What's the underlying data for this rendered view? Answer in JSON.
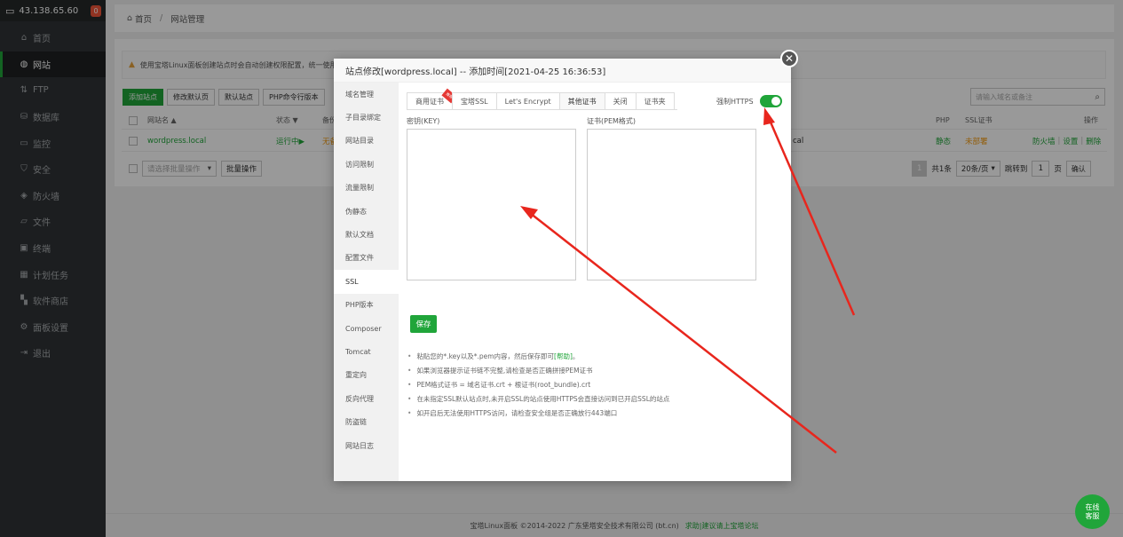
{
  "sidebar": {
    "server_ip": "43.138.65.60",
    "badge": "0",
    "items": [
      {
        "label": "首页",
        "icon": "home-icon",
        "glyph": "⌂"
      },
      {
        "label": "网站",
        "icon": "globe-icon",
        "glyph": "◍",
        "active": true
      },
      {
        "label": "FTP",
        "icon": "ftp-icon",
        "glyph": "⇅"
      },
      {
        "label": "数据库",
        "icon": "database-icon",
        "glyph": "⛁"
      },
      {
        "label": "监控",
        "icon": "monitor-icon",
        "glyph": "▭"
      },
      {
        "label": "安全",
        "icon": "shield-icon",
        "glyph": "⛉"
      },
      {
        "label": "防火墙",
        "icon": "firewall-icon",
        "glyph": "◈"
      },
      {
        "label": "文件",
        "icon": "folder-icon",
        "glyph": "▱"
      },
      {
        "label": "终端",
        "icon": "terminal-icon",
        "glyph": "▣"
      },
      {
        "label": "计划任务",
        "icon": "calendar-icon",
        "glyph": "▦"
      },
      {
        "label": "软件商店",
        "icon": "apps-icon",
        "glyph": "▚"
      },
      {
        "label": "面板设置",
        "icon": "gear-icon",
        "glyph": "⚙"
      },
      {
        "label": "退出",
        "icon": "logout-icon",
        "glyph": "⇥"
      }
    ]
  },
  "breadcrumb": {
    "home": "首页",
    "sep": "/",
    "current": "网站管理"
  },
  "notice": "使用宝塔Linux面板创建站点时会自动创建权限配置，统一使用",
  "toolbar": {
    "add_site": "添加站点",
    "modify_default": "修改默认页",
    "default_site": "默认站点",
    "php_cli": "PHP命令行版本"
  },
  "search_placeholder": "请输入域名或备注",
  "table": {
    "headers": {
      "name": "网站名 ▲",
      "status": "状态 ▼",
      "backup": "备份",
      "php": "PHP",
      "ssl": "SSL证书",
      "ops": "操作"
    },
    "row": {
      "name": "wordpress.local",
      "status": "运行中▶",
      "backup": "无备",
      "tail": "cal",
      "php": "静态",
      "ssl": "未部署",
      "firewall": "防火墙",
      "settings": "设置",
      "delete": "删除",
      "divider": "|"
    }
  },
  "footer_bar": {
    "batch_placeholder": "请选择批量操作",
    "batch_button": "批量操作",
    "page": "1",
    "total": "共1条",
    "per_page": "20条/页",
    "goto": "跳转到",
    "goto_value": "1",
    "page_unit": "页",
    "confirm": "确认"
  },
  "modal": {
    "title": "站点修改[wordpress.local] -- 添加时间[2021-04-25 16:36:53]",
    "close": "✕",
    "side_menu": [
      "域名管理",
      "子目录绑定",
      "网站目录",
      "访问限制",
      "流量限制",
      "伪静态",
      "默认文档",
      "配置文件",
      "SSL",
      "PHP版本",
      "Composer",
      "Tomcat",
      "重定向",
      "反向代理",
      "防盗链",
      "网站日志"
    ],
    "active_side": "SSL",
    "tabs": [
      {
        "label": "商用证书",
        "ribbon": "推荐"
      },
      {
        "label": "宝塔SSL"
      },
      {
        "label": "Let's Encrypt"
      },
      {
        "label": "其他证书",
        "active": true
      },
      {
        "label": "关闭"
      },
      {
        "label": "证书夹"
      }
    ],
    "force_https": "强制HTTPS",
    "force_https_enabled": true,
    "key_label": "密钥(KEY)",
    "cert_label": "证书(PEM格式)",
    "save": "保存",
    "tips": [
      {
        "text": "粘贴您的*.key以及*.pem内容，然后保存即可",
        "link": "[帮助]",
        "suffix": "。"
      },
      {
        "text": "如果浏览器提示证书链不完整,请检查是否正确拼接PEM证书"
      },
      {
        "text": "PEM格式证书 = 域名证书.crt + 根证书(root_bundle).crt"
      },
      {
        "text": "在未指定SSL默认站点时,未开启SSL的站点使用HTTPS会直接访问到已开启SSL的站点"
      },
      {
        "text": "如开启后无法使用HTTPS访问，请检查安全组是否正确放行443端口"
      }
    ]
  },
  "page_footer": {
    "copyright": "宝塔Linux面板 ©2014-2022 广东堡塔安全技术有限公司 (bt.cn)",
    "link": "求助|建议请上宝塔论坛"
  },
  "online_service": {
    "line1": "在线",
    "line2": "客服"
  },
  "colors": {
    "accent": "#20a53a",
    "sidebar": "#2f3336",
    "arrow": "#e8261d",
    "danger": "#e53935"
  }
}
